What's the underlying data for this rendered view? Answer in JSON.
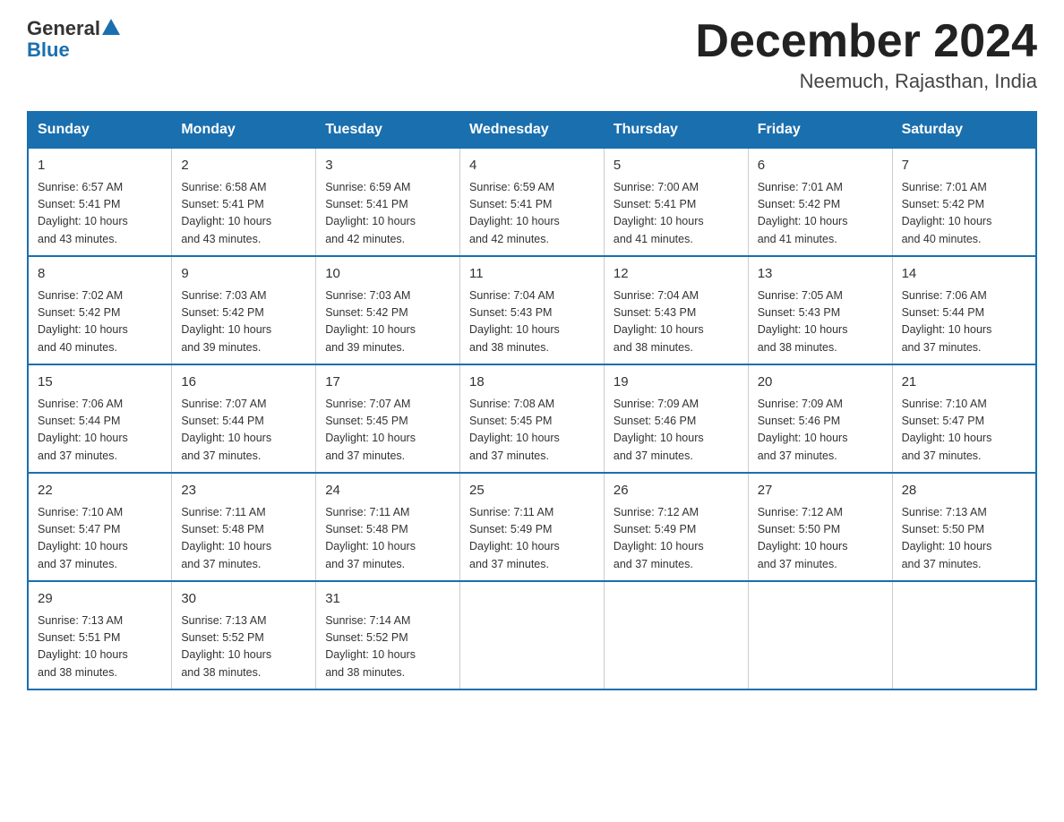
{
  "logo": {
    "text_general": "General",
    "text_blue": "Blue"
  },
  "title": "December 2024",
  "location": "Neemuch, Rajasthan, India",
  "days_of_week": [
    "Sunday",
    "Monday",
    "Tuesday",
    "Wednesday",
    "Thursday",
    "Friday",
    "Saturday"
  ],
  "weeks": [
    [
      {
        "day": "1",
        "info": "Sunrise: 6:57 AM\nSunset: 5:41 PM\nDaylight: 10 hours\nand 43 minutes."
      },
      {
        "day": "2",
        "info": "Sunrise: 6:58 AM\nSunset: 5:41 PM\nDaylight: 10 hours\nand 43 minutes."
      },
      {
        "day": "3",
        "info": "Sunrise: 6:59 AM\nSunset: 5:41 PM\nDaylight: 10 hours\nand 42 minutes."
      },
      {
        "day": "4",
        "info": "Sunrise: 6:59 AM\nSunset: 5:41 PM\nDaylight: 10 hours\nand 42 minutes."
      },
      {
        "day": "5",
        "info": "Sunrise: 7:00 AM\nSunset: 5:41 PM\nDaylight: 10 hours\nand 41 minutes."
      },
      {
        "day": "6",
        "info": "Sunrise: 7:01 AM\nSunset: 5:42 PM\nDaylight: 10 hours\nand 41 minutes."
      },
      {
        "day": "7",
        "info": "Sunrise: 7:01 AM\nSunset: 5:42 PM\nDaylight: 10 hours\nand 40 minutes."
      }
    ],
    [
      {
        "day": "8",
        "info": "Sunrise: 7:02 AM\nSunset: 5:42 PM\nDaylight: 10 hours\nand 40 minutes."
      },
      {
        "day": "9",
        "info": "Sunrise: 7:03 AM\nSunset: 5:42 PM\nDaylight: 10 hours\nand 39 minutes."
      },
      {
        "day": "10",
        "info": "Sunrise: 7:03 AM\nSunset: 5:42 PM\nDaylight: 10 hours\nand 39 minutes."
      },
      {
        "day": "11",
        "info": "Sunrise: 7:04 AM\nSunset: 5:43 PM\nDaylight: 10 hours\nand 38 minutes."
      },
      {
        "day": "12",
        "info": "Sunrise: 7:04 AM\nSunset: 5:43 PM\nDaylight: 10 hours\nand 38 minutes."
      },
      {
        "day": "13",
        "info": "Sunrise: 7:05 AM\nSunset: 5:43 PM\nDaylight: 10 hours\nand 38 minutes."
      },
      {
        "day": "14",
        "info": "Sunrise: 7:06 AM\nSunset: 5:44 PM\nDaylight: 10 hours\nand 37 minutes."
      }
    ],
    [
      {
        "day": "15",
        "info": "Sunrise: 7:06 AM\nSunset: 5:44 PM\nDaylight: 10 hours\nand 37 minutes."
      },
      {
        "day": "16",
        "info": "Sunrise: 7:07 AM\nSunset: 5:44 PM\nDaylight: 10 hours\nand 37 minutes."
      },
      {
        "day": "17",
        "info": "Sunrise: 7:07 AM\nSunset: 5:45 PM\nDaylight: 10 hours\nand 37 minutes."
      },
      {
        "day": "18",
        "info": "Sunrise: 7:08 AM\nSunset: 5:45 PM\nDaylight: 10 hours\nand 37 minutes."
      },
      {
        "day": "19",
        "info": "Sunrise: 7:09 AM\nSunset: 5:46 PM\nDaylight: 10 hours\nand 37 minutes."
      },
      {
        "day": "20",
        "info": "Sunrise: 7:09 AM\nSunset: 5:46 PM\nDaylight: 10 hours\nand 37 minutes."
      },
      {
        "day": "21",
        "info": "Sunrise: 7:10 AM\nSunset: 5:47 PM\nDaylight: 10 hours\nand 37 minutes."
      }
    ],
    [
      {
        "day": "22",
        "info": "Sunrise: 7:10 AM\nSunset: 5:47 PM\nDaylight: 10 hours\nand 37 minutes."
      },
      {
        "day": "23",
        "info": "Sunrise: 7:11 AM\nSunset: 5:48 PM\nDaylight: 10 hours\nand 37 minutes."
      },
      {
        "day": "24",
        "info": "Sunrise: 7:11 AM\nSunset: 5:48 PM\nDaylight: 10 hours\nand 37 minutes."
      },
      {
        "day": "25",
        "info": "Sunrise: 7:11 AM\nSunset: 5:49 PM\nDaylight: 10 hours\nand 37 minutes."
      },
      {
        "day": "26",
        "info": "Sunrise: 7:12 AM\nSunset: 5:49 PM\nDaylight: 10 hours\nand 37 minutes."
      },
      {
        "day": "27",
        "info": "Sunrise: 7:12 AM\nSunset: 5:50 PM\nDaylight: 10 hours\nand 37 minutes."
      },
      {
        "day": "28",
        "info": "Sunrise: 7:13 AM\nSunset: 5:50 PM\nDaylight: 10 hours\nand 37 minutes."
      }
    ],
    [
      {
        "day": "29",
        "info": "Sunrise: 7:13 AM\nSunset: 5:51 PM\nDaylight: 10 hours\nand 38 minutes."
      },
      {
        "day": "30",
        "info": "Sunrise: 7:13 AM\nSunset: 5:52 PM\nDaylight: 10 hours\nand 38 minutes."
      },
      {
        "day": "31",
        "info": "Sunrise: 7:14 AM\nSunset: 5:52 PM\nDaylight: 10 hours\nand 38 minutes."
      },
      {
        "day": "",
        "info": ""
      },
      {
        "day": "",
        "info": ""
      },
      {
        "day": "",
        "info": ""
      },
      {
        "day": "",
        "info": ""
      }
    ]
  ]
}
